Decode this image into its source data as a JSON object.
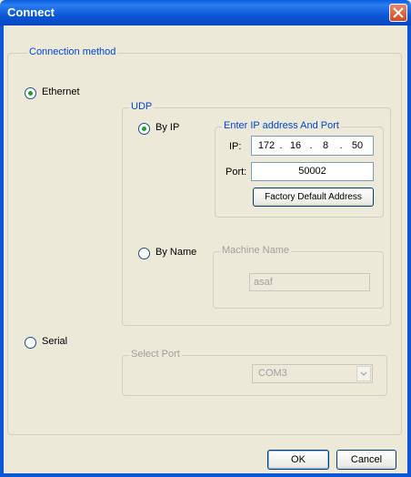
{
  "window": {
    "title": "Connect"
  },
  "connection_method": {
    "legend": "Connection method",
    "ethernet": {
      "label": "Ethernet",
      "selected": true
    },
    "serial": {
      "label": "Serial",
      "selected": false
    }
  },
  "udp": {
    "legend": "UDP",
    "by_ip": {
      "label": "By IP",
      "selected": true
    },
    "by_name": {
      "label": "By Name",
      "selected": false
    },
    "ip_group": {
      "legend": "Enter IP address And Port",
      "ip_label": "IP:",
      "ip_octets": [
        "172",
        "16",
        "8",
        "50"
      ],
      "port_label": "Port:",
      "port_value": "50002",
      "factory_button": "Factory Default Address"
    },
    "name_group": {
      "legend": "Machine Name",
      "value": "asaf"
    }
  },
  "serial_port": {
    "legend": "Select Port",
    "value": "COM3"
  },
  "buttons": {
    "ok": "OK",
    "cancel": "Cancel"
  },
  "icons": {
    "close": "close-icon",
    "dropdown": "chevron-down-icon"
  }
}
